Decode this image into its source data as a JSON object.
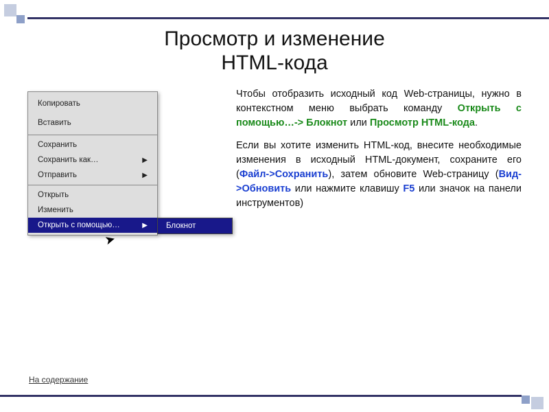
{
  "title_line1": "Просмотр и изменение",
  "title_line2": "HTML-кода",
  "menu": {
    "copy": "Копировать",
    "paste": "Вставить",
    "save": "Сохранить",
    "saveas": "Сохранить как…",
    "send": "Отправить",
    "open": "Открыть",
    "edit": "Изменить",
    "openwith": "Открыть с помощью…",
    "notepad": "Блокнот"
  },
  "body": {
    "p1_a": "Чтобы отобразить исходный код Web-страницы, нужно в контекстном меню выбрать команду ",
    "p1_hl1": "Открыть с помощью…-> Блокнот",
    "p1_b": " или ",
    "p1_hl2": "Просмотр HTML-кода",
    "p1_c": ".",
    "p2_a": "Если вы хотите изменить HTML-код, внесите необходимые изменения в исходный HTML-документ, сохраните его (",
    "p2_hl1": "Файл->Сохранить",
    "p2_b": "), затем обновите Web-страницу (",
    "p2_hl2": "Вид->Обновить",
    "p2_c": " или нажмите клавишу ",
    "p2_hl3": "F5",
    "p2_d": " или значок ",
    "p2_e": " на панели инструментов)"
  },
  "footer": "На содержание"
}
